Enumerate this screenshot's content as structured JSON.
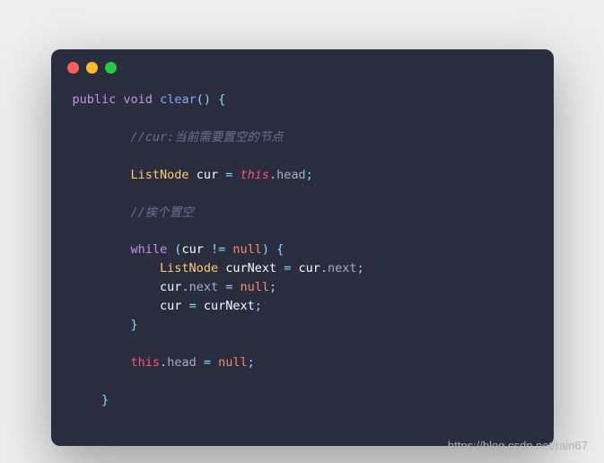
{
  "window": {
    "dots": {
      "red": "#ff5f56",
      "yellow": "#ffbd2e",
      "green": "#27c93f"
    }
  },
  "code": {
    "l1": {
      "public": "public",
      "void": "void",
      "clear": "clear",
      "parens": "()",
      "brace": " {"
    },
    "l3": {
      "cmt": "//cur:当前需要置空的节点"
    },
    "l5": {
      "type": "ListNode",
      "cur": "cur",
      "eq": " = ",
      "this": "this",
      "dot": ".",
      "head": "head",
      "semi": ";"
    },
    "l7": {
      "cmt": "//挨个置空"
    },
    "l9": {
      "while": "while",
      "open": " (",
      "cur": "cur",
      "neq": " != ",
      "null": "null",
      "close": ")",
      "brace": " {"
    },
    "l10": {
      "type": "ListNode",
      "cnext": "curNext",
      "eq": " = ",
      "cur": "cur",
      "dot": ".",
      "next": "next",
      "semi": ";"
    },
    "l11": {
      "cur": "cur",
      "dot": ".",
      "next": "next",
      "eq": " = ",
      "null": "null",
      "semi": ";"
    },
    "l12": {
      "cur": "cur",
      "eq": " = ",
      "cnext": "curNext",
      "semi": ";"
    },
    "l13": {
      "brace": "}"
    },
    "l15": {
      "this": "this",
      "dot": ".",
      "head": "head",
      "eq": " = ",
      "null": "null",
      "semi": ";"
    },
    "l17": {
      "brace": "}"
    }
  },
  "watermark": "https://blog.csdn.net/rain67"
}
